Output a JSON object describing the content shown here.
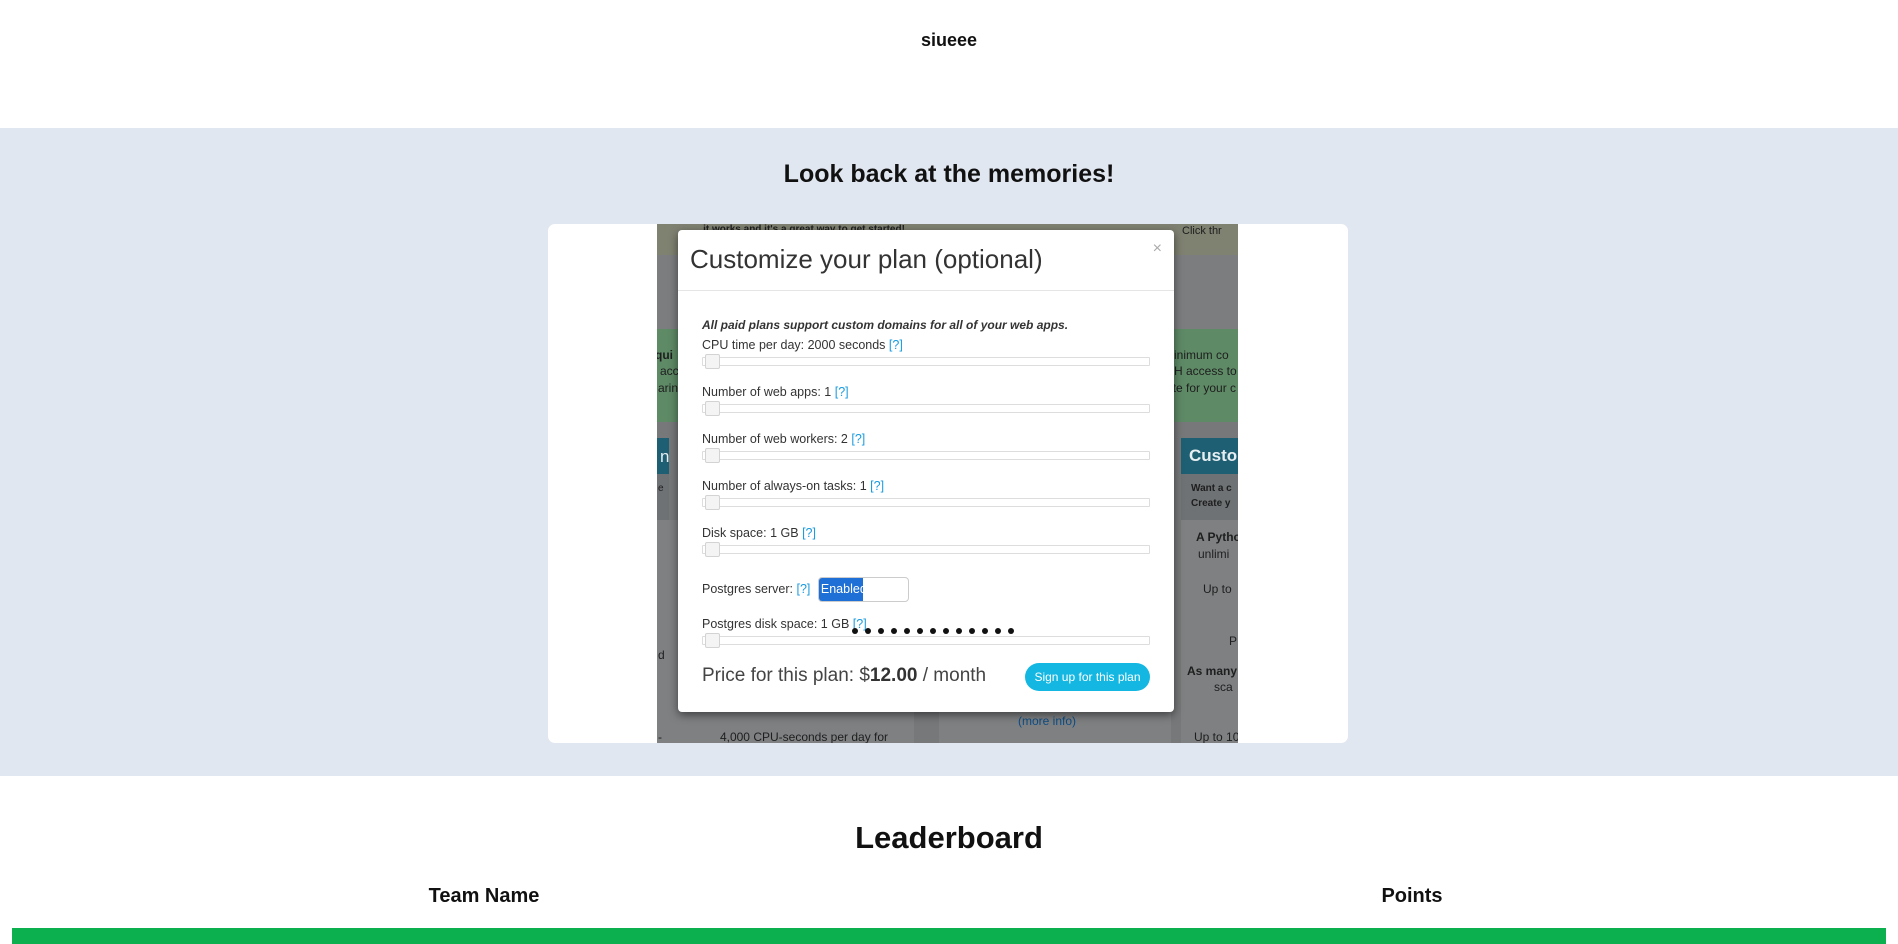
{
  "header": {
    "title": "siueee"
  },
  "memories": {
    "title": "Look back at the memories!",
    "slide_count": 13,
    "screenshot": {
      "background_text": {
        "top_center": "it works and it's a great way to get started!",
        "top_right": "Click thr",
        "left": [
          "-qui",
          "acc",
          "arin",
          "n",
          "e",
          "d",
          "-"
        ],
        "right_green": [
          "minimum co",
          "SH access to",
          "ate for your c"
        ],
        "right_card_header": "Custom",
        "right_card": [
          "Want a c",
          "Create y",
          "A Pytho",
          "unlimi",
          "Up to",
          "P",
          "As many",
          "sca",
          "Up to 10"
        ],
        "more_info": "(more info)",
        "bottom_left": "4,000 CPU-seconds per day for"
      },
      "modal": {
        "title": "Customize your plan (optional)",
        "close": "×",
        "note": "All paid plans support custom domains for all of your web apps.",
        "help": "[?]",
        "sliders": [
          {
            "label": "CPU time per day: 2000 seconds"
          },
          {
            "label": "Number of web apps: 1"
          },
          {
            "label": "Number of web workers: 2"
          },
          {
            "label": "Number of always-on tasks: 1"
          },
          {
            "label": "Disk space: 1 GB"
          }
        ],
        "postgres_label": "Postgres server:",
        "postgres_toggle": "Enabled",
        "postgres_disk_label": "Postgres disk space: 1 GB",
        "price_prefix": "Price for this plan: $",
        "price_value": "12.00",
        "price_suffix": " / month",
        "signup": "Sign up for this plan"
      }
    }
  },
  "leaderboard": {
    "title": "Leaderboard",
    "columns": [
      "Team Name",
      "Points"
    ]
  },
  "colors": {
    "section_bg": "#e1e7f0",
    "accent_green": "#0cb04f",
    "signup_button": "#13b7e2",
    "toggle_on": "#1e6fd6"
  }
}
